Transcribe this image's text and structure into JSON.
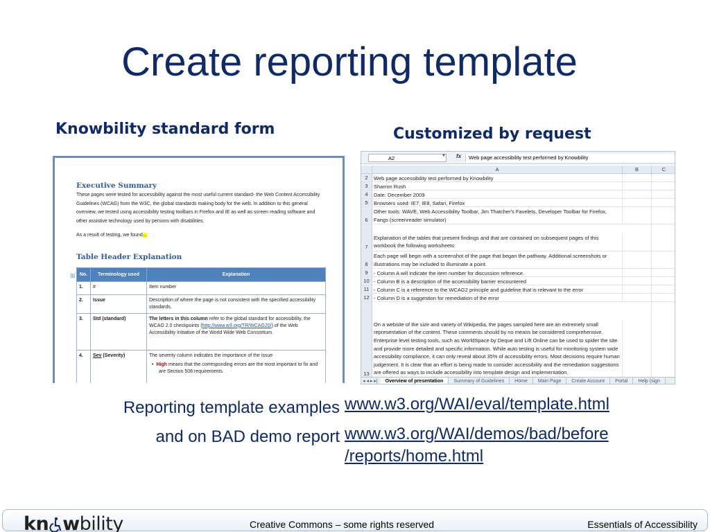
{
  "slide": {
    "title": "Create reporting template",
    "left_heading": "Knowbility standard form",
    "right_heading": "Customized  by request"
  },
  "document": {
    "exec_heading": "Executive Summary",
    "exec_body": "These pages were tested for accessibility against the most useful current standard- the Web Content Accessibility Guidelines (WCAG) from the W3C, the global standards making body for the web.  In addition to this general overview, we tested using accessibility testing toolbars in Firefox and IE as well as screen reading software and other assistive technology used by persons with disabilities.",
    "result_text": "As a result of testing, we found",
    "result_highlight": "...",
    "table_heading": "Table Header Explanation",
    "table_headers": [
      "No.",
      "Terminology used",
      "Explanation"
    ],
    "rows": [
      {
        "no": "1.",
        "term": "#",
        "expl": "Item number"
      },
      {
        "no": "2.",
        "term": "Issue",
        "expl": "Description of where the page is not consistent with the specified accessibility standards."
      },
      {
        "no": "3.",
        "term": "Std (standard)",
        "expl_bold": "The letters in this column",
        "expl_a": " refer to the global standard for accessibility, the WCAG 2.0 checkpoints (",
        "expl_link": "http://www.w3.org/TR/WCAG20/",
        "expl_b": ") of the Web Accessibility Initiative of the World Wide Web Consortium."
      },
      {
        "no": "4.",
        "term_u": "Sev",
        "term_rest": " (Severity)",
        "expl": "The severity column indicates the importance of the issue",
        "bullet_red": "High",
        "bullet_rest": " means that the corresponding errors are the most important to fix and are Section 508 requirements."
      }
    ]
  },
  "spreadsheet": {
    "name_box": "A2",
    "fx_label": "fx",
    "formula": "Web page accessibility test performed by Knowbility",
    "col_headers": [
      "A",
      "B",
      "C"
    ],
    "rows": [
      {
        "n": "2",
        "a": "Web page accessibility test performed by Knowbility"
      },
      {
        "n": "3",
        "a": "Sharron Rush"
      },
      {
        "n": "4",
        "a": "Date: December 2009"
      },
      {
        "n": "5",
        "a": "Browsers used:  IE7, IE8, Safari, Firefox"
      },
      {
        "n": "6",
        "a": "Other tools:  WAVE, Web Accessibility Toolbar, Jim Thatcher's Favelets, Developer Toolbar for Firefox, Fangs (screenreader simulator)"
      },
      {
        "n": "7",
        "a": "Explanation of the tables that present findings and that are contained on subsequent pages of this workbook the following worksheets:"
      },
      {
        "n": "8",
        "a": "Each page will begin with a screenshot of the page that began the pathway.  Additional screenshots or illustrations may be included to illuminate a point."
      },
      {
        "n": "9",
        "a": " - Column A will indicate the item number for discussion reference."
      },
      {
        "n": "10",
        "a": " - Column B is a description of the accessibility barrier encountered"
      },
      {
        "n": "11",
        "a": " - Column C is a reference to the WCAG2 principle and guideline that is relevant to the error"
      },
      {
        "n": "12",
        "a": " - Column D is a suggestion for remediation of the error"
      },
      {
        "n": "13",
        "a": "On a website of the size and variety of Wikipedia, the pages sampled here are an extremely small representation of the content.  These comments should by no means be considered comprehensive.  Enterprise level testing tools, such as WorldSpace by Deque and Lift Online can be used to spider the site and provide more detailed and specific information.  While auto testing is useful for monitoring system wide accessibility compliance, it can only reveal about 35% of accessibility errors.  Most decisions require human judgement.  It is clear that an effort is being made to consider accessibility and the remediation suggestions are offered as ways to include accessibility into template design and implementation."
      }
    ],
    "tab_nav": "◂ ◂ ▸ ▸|",
    "tabs": [
      "Overview of presentation",
      "Summary of Guidelines",
      "Home",
      "Main Page",
      "Create Account",
      "Portal",
      "Help (sign"
    ]
  },
  "captions": {
    "line1": "Reporting template examples",
    "line2": "and on BAD demo report",
    "url1": "www.w3.org/WAI/eval/template.html",
    "url2a": "www.w3.org/WAI/demos/bad/before",
    "url2b": "/reports/home.html"
  },
  "footer": {
    "logo_a": "kn",
    "logo_b": "w",
    "logo_c": "bility",
    "center": "Creative Commons – some rights reserved",
    "right": "Essentials of Accessibility"
  }
}
